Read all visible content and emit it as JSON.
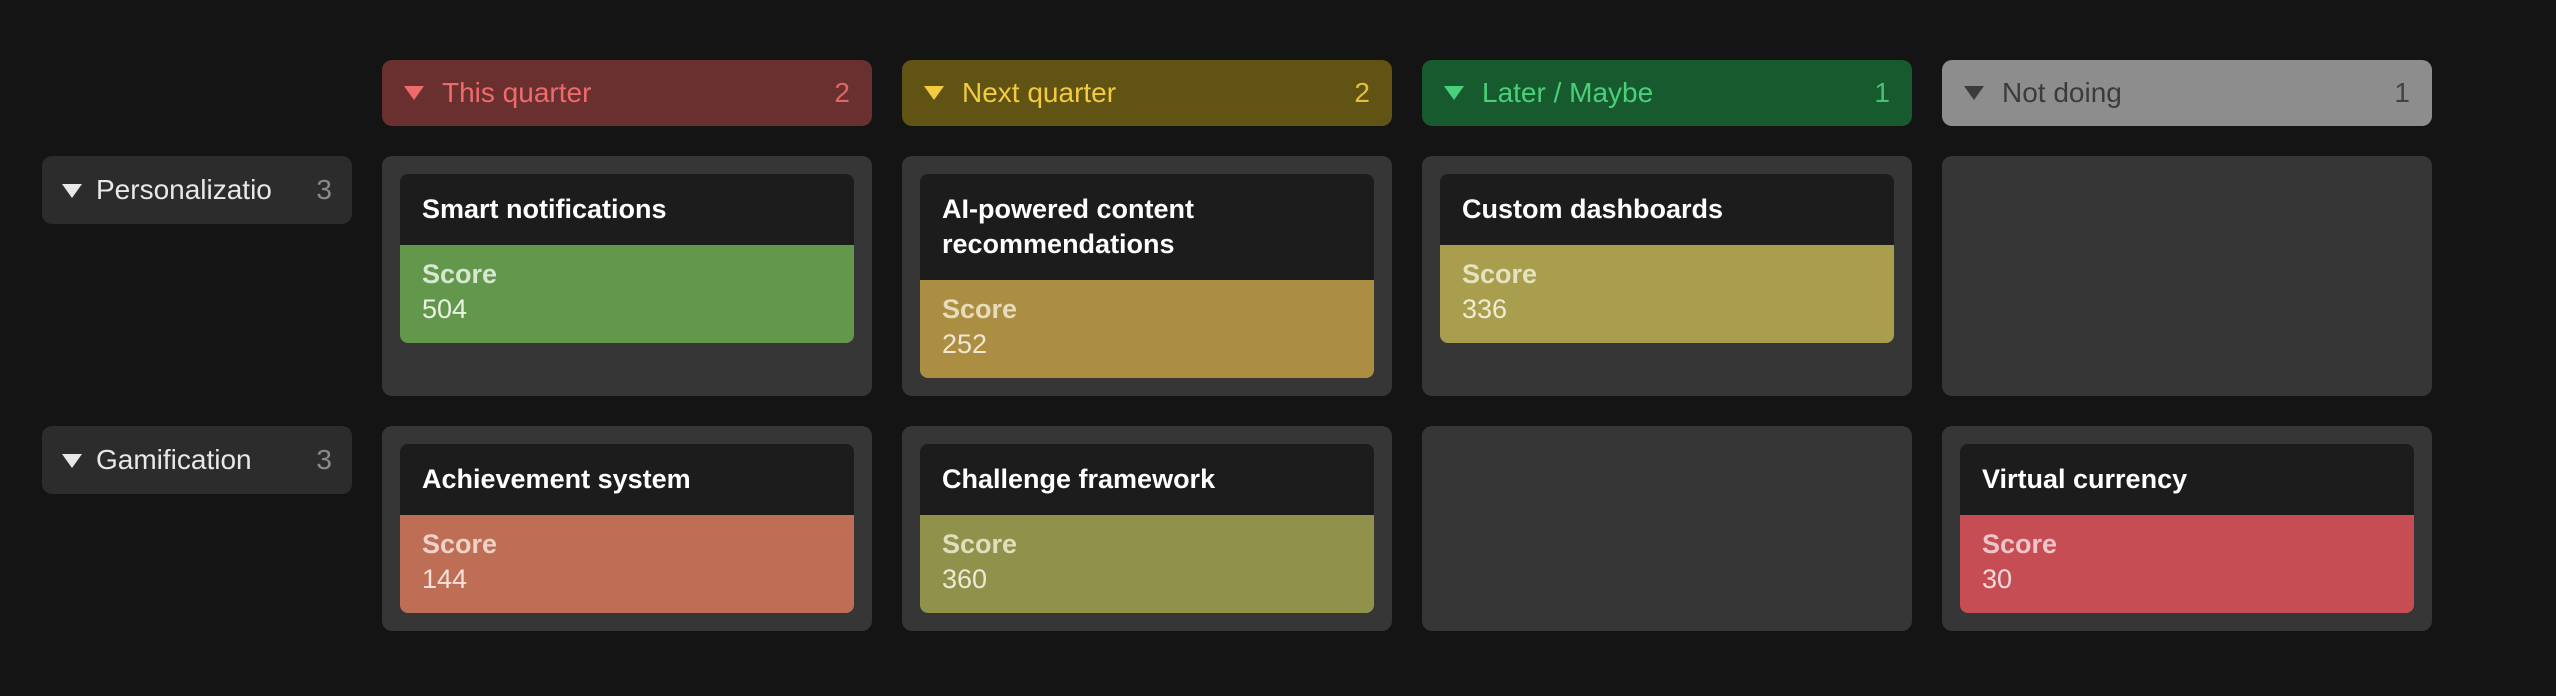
{
  "columns": [
    {
      "id": "this-quarter",
      "label": "This quarter",
      "count": "2",
      "style": "col-red"
    },
    {
      "id": "next-quarter",
      "label": "Next quarter",
      "count": "2",
      "style": "col-yellow"
    },
    {
      "id": "later-maybe",
      "label": "Later / Maybe",
      "count": "1",
      "style": "col-green"
    },
    {
      "id": "not-doing",
      "label": "Not doing",
      "count": "1",
      "style": "col-gray"
    }
  ],
  "rows": [
    {
      "id": "personalization",
      "label": "Personalizatio",
      "count": "3"
    },
    {
      "id": "gamification",
      "label": "Gamification",
      "count": "3"
    }
  ],
  "score_label": "Score",
  "cards": {
    "personalization_this-quarter": {
      "title": "Smart notifications",
      "score": "504",
      "style": "score-green"
    },
    "personalization_next-quarter": {
      "title": "AI-powered content recommendations",
      "score": "252",
      "style": "score-olive"
    },
    "personalization_later-maybe": {
      "title": "Custom dashboards",
      "score": "336",
      "style": "score-olive2"
    },
    "gamification_this-quarter": {
      "title": "Achievement system",
      "score": "144",
      "style": "score-brown"
    },
    "gamification_next-quarter": {
      "title": "Challenge framework",
      "score": "360",
      "style": "score-olive3"
    },
    "gamification_not-doing": {
      "title": "Virtual currency",
      "score": "30",
      "style": "score-red"
    }
  }
}
